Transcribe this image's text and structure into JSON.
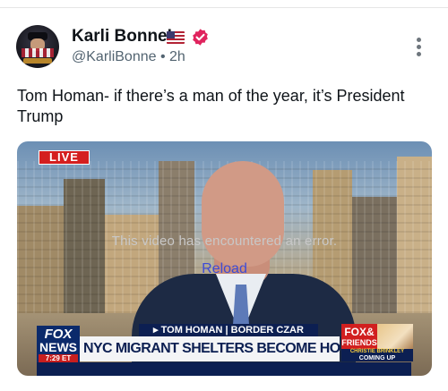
{
  "post": {
    "author_name": "Karli Bonne’",
    "flag_emoji": "us-flag-emoji",
    "verified_icon": "verified-badge-icon",
    "handle": "@KarliBonne",
    "separator": "•",
    "time": "2h",
    "more_icon": "more-vertical-icon",
    "text": "Tom Homan- if there’s a man of the year, it’s President Trump"
  },
  "video": {
    "live_label": "LIVE",
    "error_message": "This video has encountered an error.",
    "reload_label": "Reload",
    "lower_third": {
      "name_strip": "▸ TOM HOMAN | BORDER CZAR",
      "headline": "NYC MIGRANT SHELTERS BECOME HOTBED FOR CRIME",
      "channel_top": "FOX",
      "channel_bottom": "NEWS",
      "clock": "7:29 ET",
      "program_top": "FOX&",
      "program_bottom": "FRIENDS",
      "upnext_name": "CHRISTIE BRINKLEY",
      "upnext_label": "COMING UP"
    }
  },
  "colors": {
    "verified": "#e0245e",
    "live": "#d41f1f",
    "reload_link": "#3d4bd6",
    "fox_navy": "#0c1f52"
  }
}
